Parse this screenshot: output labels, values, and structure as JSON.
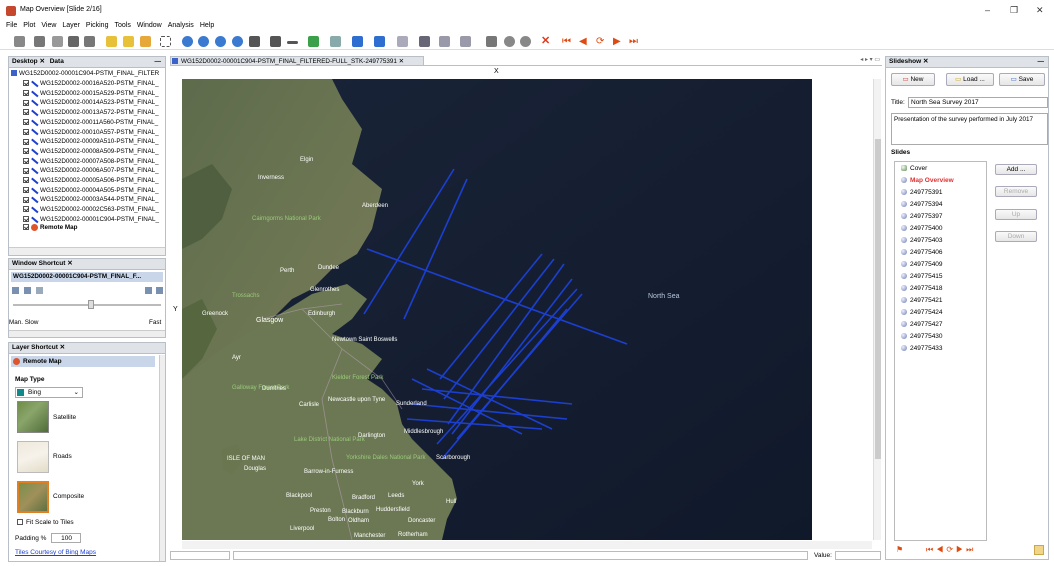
{
  "window": {
    "title": "Map Overview [Slide 2/16]",
    "controls": [
      "–",
      "❐",
      "✕"
    ]
  },
  "menu": [
    "File",
    "Plot",
    "View",
    "Layer",
    "Picking",
    "Tools",
    "Window",
    "Analysis",
    "Help"
  ],
  "desktop_panel": {
    "tabs": [
      "Desktop",
      "Data"
    ],
    "root": "WG152D0002-00001C904-PSTM_FINAL_FILTER",
    "items": [
      "WG152D0002-00016A520-PSTM_FINAL_",
      "WG152D0002-00015A529-PSTM_FINAL_",
      "WG152D0002-00014A523-PSTM_FINAL_",
      "WG152D0002-00013A572-PSTM_FINAL_",
      "WG152D0002-00011A560-PSTM_FINAL_",
      "WG152D0002-00010A557-PSTM_FINAL_",
      "WG152D0002-00009A510-PSTM_FINAL_",
      "WG152D0002-00008A509-PSTM_FINAL_",
      "WG152D0002-00007A508-PSTM_FINAL_",
      "WG152D0002-00006A507-PSTM_FINAL_",
      "WG152D0002-00005A506-PSTM_FINAL_",
      "WG152D0002-00004A505-PSTM_FINAL_",
      "WG152D0002-00003A544-PSTM_FINAL_",
      "WG152D0002-00002C563-PSTM_FINAL_",
      "WG152D0002-00001C904-PSTM_FINAL_"
    ],
    "remote_map": "Remote Map"
  },
  "window_shortcut": {
    "title": "Window Shortcut",
    "current": "WG152D0002-00001C904-PSTM_FINAL_F...",
    "slow_label": "Man. Slow",
    "fast_label": "Fast"
  },
  "layer_shortcut": {
    "title": "Layer Shortcut",
    "layer": "Remote Map",
    "map_type_label": "Map Type",
    "provider": "Bing",
    "options": [
      "Satellite",
      "Roads",
      "Composite"
    ],
    "fit_scale": "Fit Scale to Tiles",
    "padding_label": "Padding %",
    "padding_value": "100",
    "credit": "Tiles Courtesy of Bing Maps"
  },
  "map": {
    "tab": "WG152D0002-00001C904-PSTM_FINAL_FILTERED-FULL_STK-249775391",
    "x_label": "X",
    "y_label": "Y",
    "value_label": "Value:",
    "sea_label": "North Sea",
    "places": [
      "Inverness",
      "Aberdeen",
      "Cairngorms National Park",
      "Perth",
      "Dundee",
      "Glenrothes",
      "Trossachs",
      "Greenock",
      "Glasgow",
      "Edinburgh",
      "Newtown Saint Boswells",
      "Ayr",
      "Kielder Forest Park",
      "Galloway Forest Park",
      "Dumfries",
      "Newcastle upon Tyne",
      "Sunderland",
      "Carlisle",
      "Middlesbrough",
      "Darlington",
      "Lake District National Park",
      "Scarborough",
      "ISLE OF MAN",
      "Douglas",
      "Barrow-in-Furness",
      "Yorkshire Dales National Park",
      "York",
      "Blackpool",
      "Preston",
      "Blackburn",
      "Bradford",
      "Leeds",
      "Huddersfield",
      "Oldham",
      "Bolton",
      "Doncaster",
      "Hull",
      "Liverpool",
      "Manchester",
      "Rotherham",
      "Elgin"
    ]
  },
  "slideshow": {
    "title": "Slideshow",
    "new_label": "New",
    "load_label": "Load ...",
    "save_label": "Save",
    "title_label": "Title:",
    "title_value": "North Sea Survey 2017",
    "description": "Presentation of the survey performed in July 2017",
    "slides_label": "Slides",
    "slides": [
      "Cover",
      "Map Overview",
      "249775391",
      "249775394",
      "249775397",
      "249775400",
      "249775403",
      "249775406",
      "249775409",
      "249775415",
      "249775418",
      "249775421",
      "249775424",
      "249775427",
      "249775430",
      "249775433"
    ],
    "add_label": "Add ...",
    "remove_label": "Remove",
    "up_label": "Up",
    "down_label": "Down"
  },
  "colors": {
    "accent": "#1c3fd0",
    "selected_slide": "#e03030",
    "panel_header": "#dfe3e8"
  }
}
